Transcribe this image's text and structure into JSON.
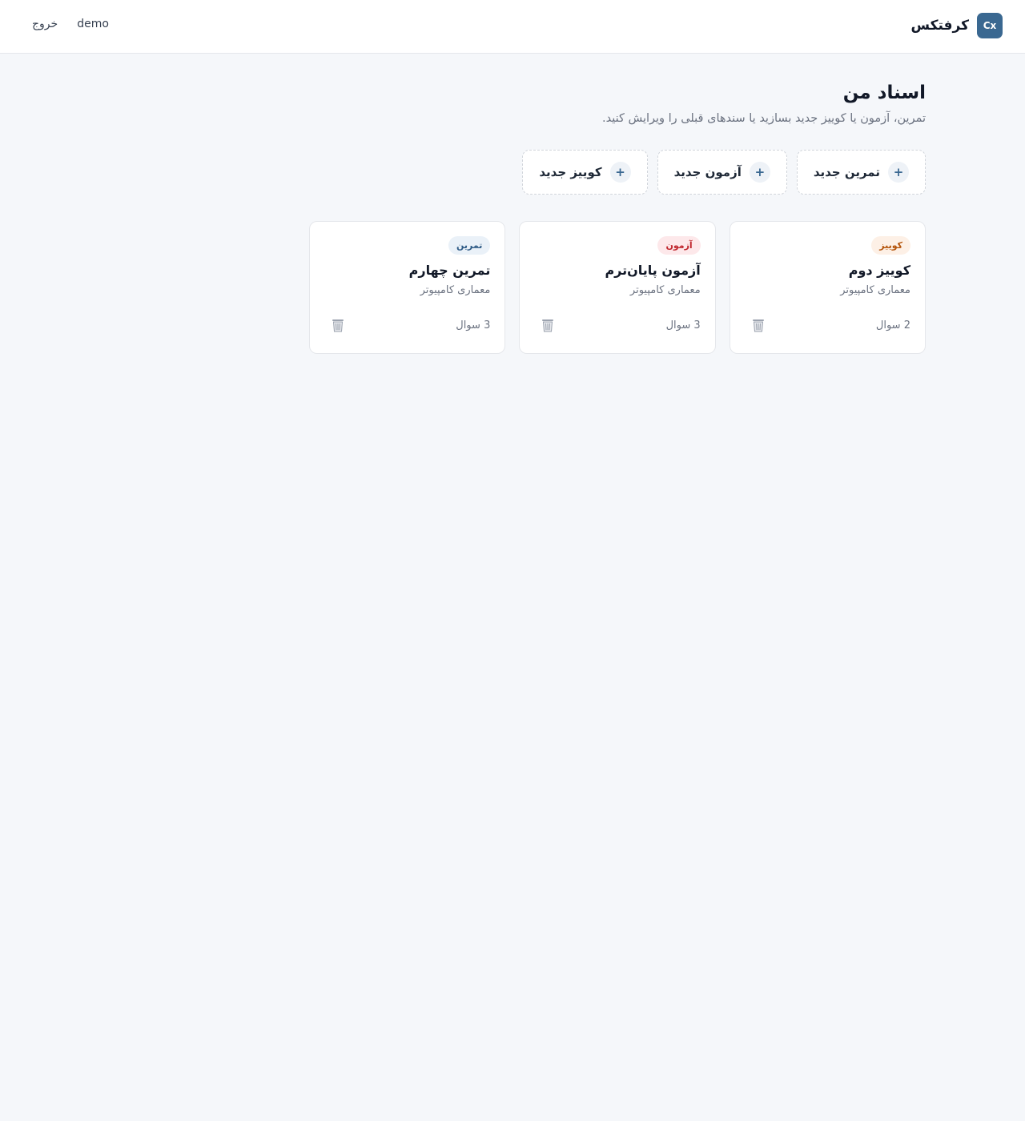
{
  "header": {
    "logo_text": "Cx",
    "brand_name": "کرفتکس",
    "user_name": "demo",
    "logout_label": "خروج"
  },
  "main": {
    "title": "اسناد من",
    "subtitle": "تمرین، آزمون یا کوییز جدید بسازید یا سندهای قبلی را ویرایش کنید.",
    "create_buttons": [
      {
        "label": "تمرین جدید",
        "icon": "plus-icon"
      },
      {
        "label": "آزمون جدید",
        "icon": "plus-icon"
      },
      {
        "label": "کوییز جدید",
        "icon": "plus-icon"
      }
    ],
    "cards": [
      {
        "badge": "کوییز",
        "title": "کوییز دوم",
        "course": "معماری کامپیوتر",
        "count": "2 سوال"
      },
      {
        "badge": "آزمون",
        "title": "آزمون پایان‌ترم",
        "course": "معماری کامپیوتر",
        "count": "3 سوال"
      },
      {
        "badge": "تمرین",
        "title": "تمرین چهارم",
        "course": "معماری کامپیوتر",
        "count": "3 سوال"
      }
    ]
  },
  "colors": {
    "brand": "#3a6891",
    "quiz_badge_bg": "#fdf0e6",
    "quiz_badge_text": "#b45309",
    "exam_badge_bg": "#fde8ea",
    "exam_badge_text": "#c0262d",
    "exercise_badge_bg": "#eaf1f8",
    "exercise_badge_text": "#2f5b86"
  }
}
